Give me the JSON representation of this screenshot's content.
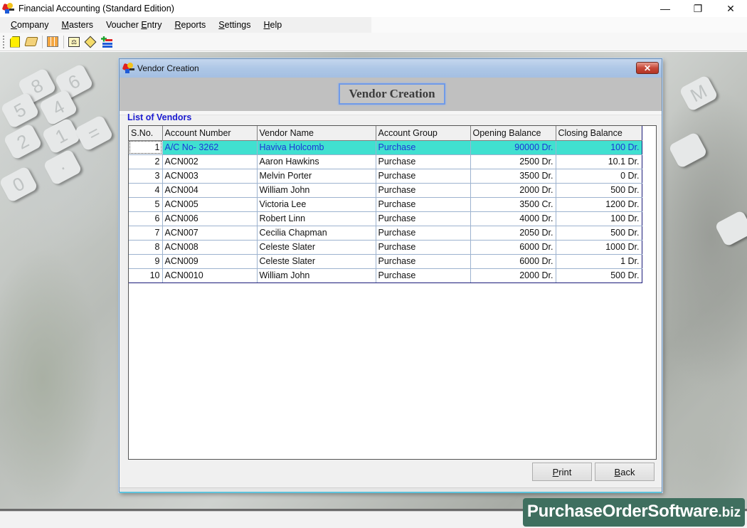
{
  "app": {
    "title": "Financial Accounting (Standard Edition)",
    "window_controls": {
      "minimize": "—",
      "restore": "❐",
      "close": "✕"
    }
  },
  "menu": [
    {
      "label": "Company",
      "mnemonic": "C"
    },
    {
      "label": "Masters",
      "mnemonic": "M"
    },
    {
      "label": "Voucher Entry",
      "mnemonic": "E"
    },
    {
      "label": "Reports",
      "mnemonic": "R"
    },
    {
      "label": "Settings",
      "mnemonic": "S"
    },
    {
      "label": "Help",
      "mnemonic": "H"
    }
  ],
  "toolbar": {
    "buttons": [
      "new-icon",
      "open-folder-icon",
      "grid-icon",
      "balance-scale-icon",
      "diamond-icon",
      "add-list-icon"
    ]
  },
  "dialog": {
    "title": "Vendor Creation",
    "close_label": "✕",
    "header_title": "Vendor Creation",
    "section_label": "List of Vendors",
    "columns": [
      "S.No.",
      "Account Number",
      "Vendor Name",
      "Account Group",
      "Opening Balance",
      "Closing Balance"
    ],
    "rows": [
      {
        "sno": "1",
        "account": "A/C No- 3262",
        "name": "Haviva Holcomb",
        "group": "Purchase",
        "opening": "90000 Dr.",
        "closing": "100 Dr.",
        "selected": true
      },
      {
        "sno": "2",
        "account": "ACN002",
        "name": "Aaron Hawkins",
        "group": "Purchase",
        "opening": "2500 Dr.",
        "closing": "10.1 Dr."
      },
      {
        "sno": "3",
        "account": "ACN003",
        "name": "Melvin Porter",
        "group": "Purchase",
        "opening": "3500 Dr.",
        "closing": "0 Dr."
      },
      {
        "sno": "4",
        "account": "ACN004",
        "name": "William John",
        "group": "Purchase",
        "opening": "2000 Dr.",
        "closing": "500 Dr."
      },
      {
        "sno": "5",
        "account": "ACN005",
        "name": "Victoria Lee",
        "group": "Purchase",
        "opening": "3500 Cr.",
        "closing": "1200 Dr."
      },
      {
        "sno": "6",
        "account": "ACN006",
        "name": "Robert Linn",
        "group": "Purchase",
        "opening": "4000 Dr.",
        "closing": "100 Dr."
      },
      {
        "sno": "7",
        "account": "ACN007",
        "name": "Cecilia Chapman",
        "group": "Purchase",
        "opening": "2050 Dr.",
        "closing": "500 Dr."
      },
      {
        "sno": "8",
        "account": "ACN008",
        "name": "Celeste Slater",
        "group": "Purchase",
        "opening": "6000 Dr.",
        "closing": "1000 Dr."
      },
      {
        "sno": "9",
        "account": "ACN009",
        "name": "Celeste Slater",
        "group": "Purchase",
        "opening": "6000 Dr.",
        "closing": "1 Dr."
      },
      {
        "sno": "10",
        "account": "ACN0010",
        "name": "William John",
        "group": "Purchase",
        "opening": "2000 Dr.",
        "closing": "500 Dr."
      }
    ],
    "buttons": {
      "print": "Print",
      "print_mnemonic": "P",
      "back": "Back",
      "back_mnemonic": "B"
    }
  },
  "watermark": {
    "main": "PurchaseOrderSoftware",
    "suffix": ".biz"
  },
  "colors": {
    "selected_row_bg": "#40e0d0",
    "selected_row_text": "#1d35d6",
    "section_label": "#1b1bd0",
    "watermark_bg": "#3f6f5f"
  }
}
